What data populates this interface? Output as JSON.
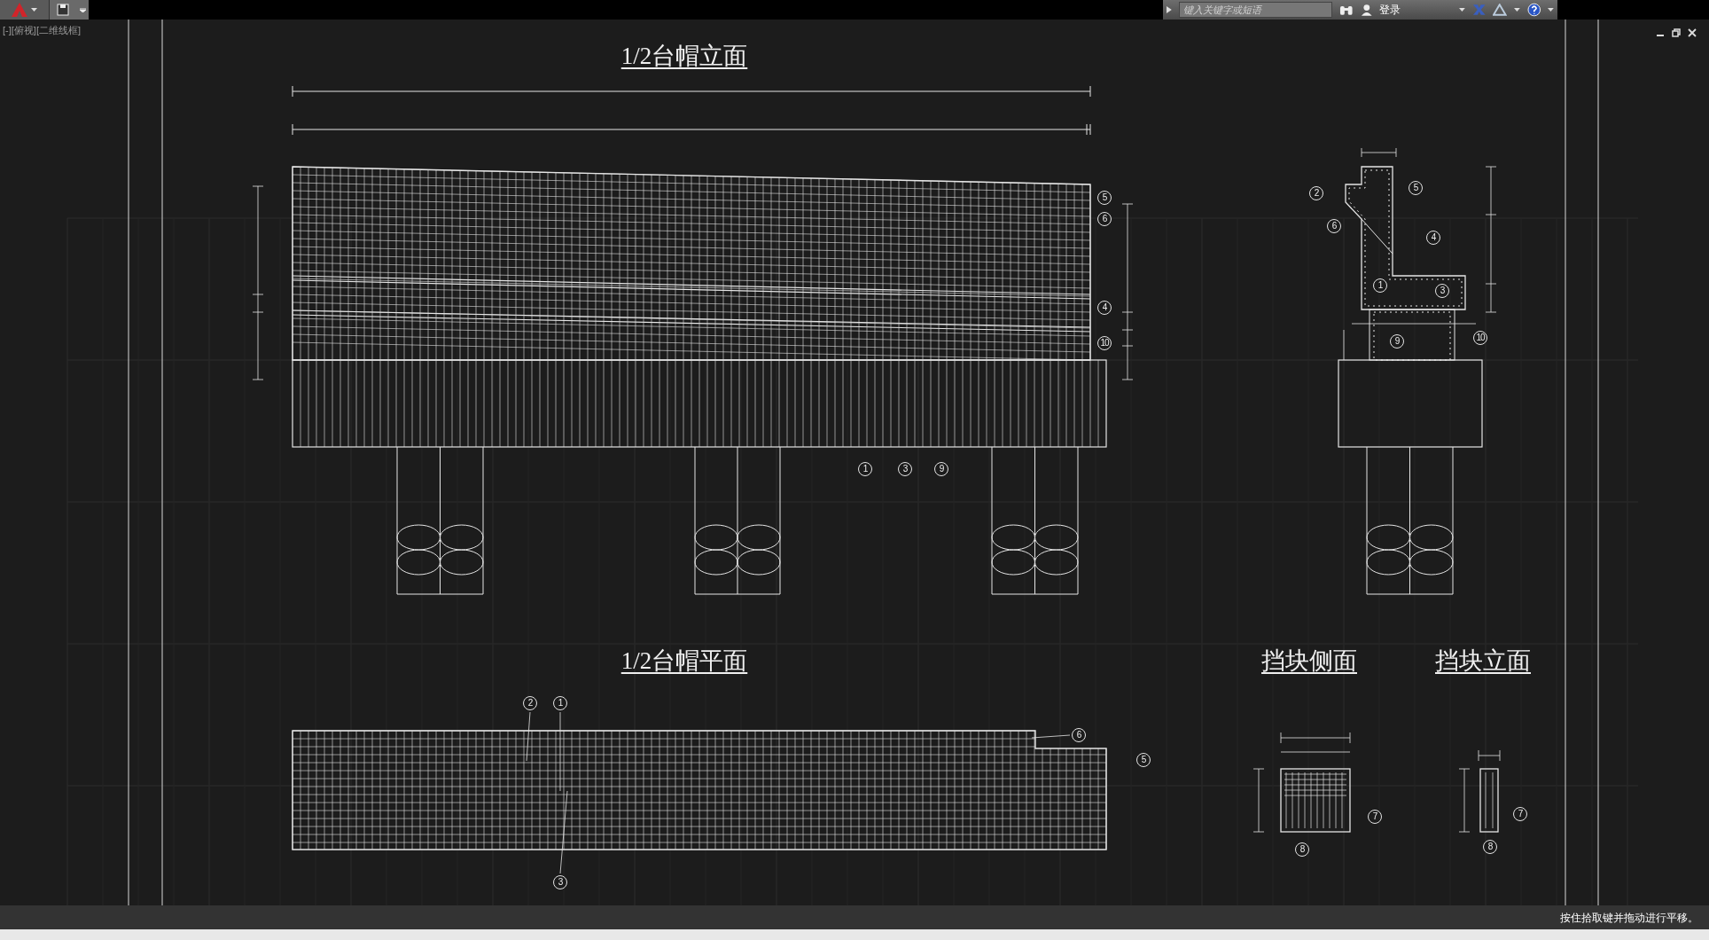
{
  "app_bar": {
    "search": {
      "placeholder": "键入关键字或短语"
    },
    "login": "登录"
  },
  "viewport": {
    "label": "[-][俯视][二维线框]"
  },
  "drawings": [
    {
      "kind": "cap_elevation",
      "title": "1/2台帽立面",
      "callouts": [
        "5",
        "6",
        "4",
        "10",
        "1",
        "3",
        "9"
      ]
    },
    {
      "kind": "cap_section",
      "callouts": [
        "2",
        "5",
        "6",
        "4",
        "1",
        "3",
        "9",
        "10"
      ]
    },
    {
      "kind": "cap_plan",
      "title": "1/2台帽平面",
      "callouts": [
        "2",
        "1",
        "3",
        "6",
        "5"
      ]
    },
    {
      "kind": "block_side",
      "title": "挡块侧面",
      "callouts": [
        "7",
        "8"
      ]
    },
    {
      "kind": "block_elevation",
      "title": "挡块立面",
      "callouts": [
        "7",
        "8"
      ]
    }
  ],
  "status_bar": {
    "message": "按住拾取键并拖动进行平移。"
  }
}
